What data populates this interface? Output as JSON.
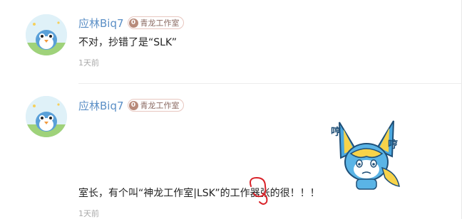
{
  "comments": [
    {
      "username": "应林Biq7",
      "badge_level": "0",
      "badge_name": "青龙工作室",
      "text": "不对，抄错了是“SLK”",
      "time": "1天前"
    },
    {
      "username": "应林Biq7",
      "badge_level": "0",
      "badge_name": "青龙工作室",
      "text_before": "室长，有个叫“神龙工作室|LSK”的工作",
      "text_circled": "器",
      "text_after": "张的很！！！",
      "time": "1天前",
      "sticker_text": [
        "哼",
        "哼"
      ]
    }
  ],
  "colors": {
    "username": "#5b8fc6",
    "badge_accent": "#b88b7b",
    "annotation_red": "#d9232a"
  },
  "icons": [
    "avatar-bird-icon",
    "fan-badge-icon",
    "sticker-fox-icon"
  ]
}
